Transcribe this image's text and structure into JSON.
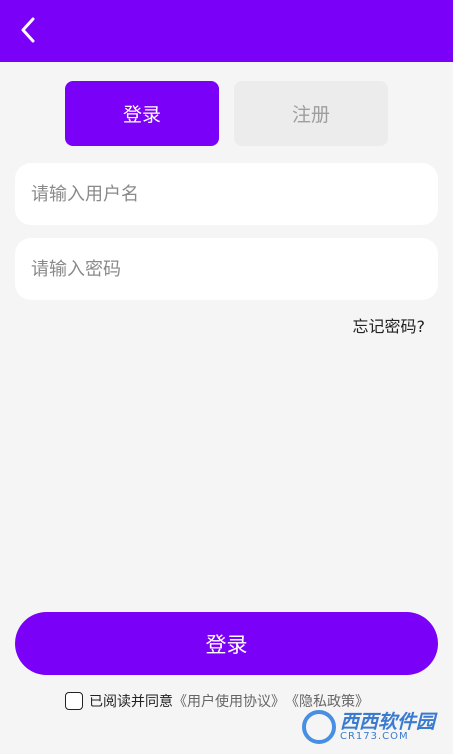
{
  "header": {
    "back_icon": "chevron-left-icon",
    "color": "#7b00f8"
  },
  "tabs": [
    {
      "label": "登录",
      "active": true
    },
    {
      "label": "注册",
      "active": false
    }
  ],
  "form": {
    "username_placeholder": "请输入用户名",
    "username_value": "",
    "password_placeholder": "请输入密码",
    "password_value": "",
    "forgot_label": "忘记密码?",
    "submit_label": "登录"
  },
  "agreement": {
    "checked": false,
    "prefix": "已阅读并同意",
    "user_agreement": "《用户使用协议》",
    "privacy_policy": "《隐私政策》"
  },
  "watermark": {
    "main": "西西软件园",
    "sub": "CR173.COM"
  },
  "colors": {
    "accent": "#7b00f8",
    "background": "#f4f5f4"
  }
}
